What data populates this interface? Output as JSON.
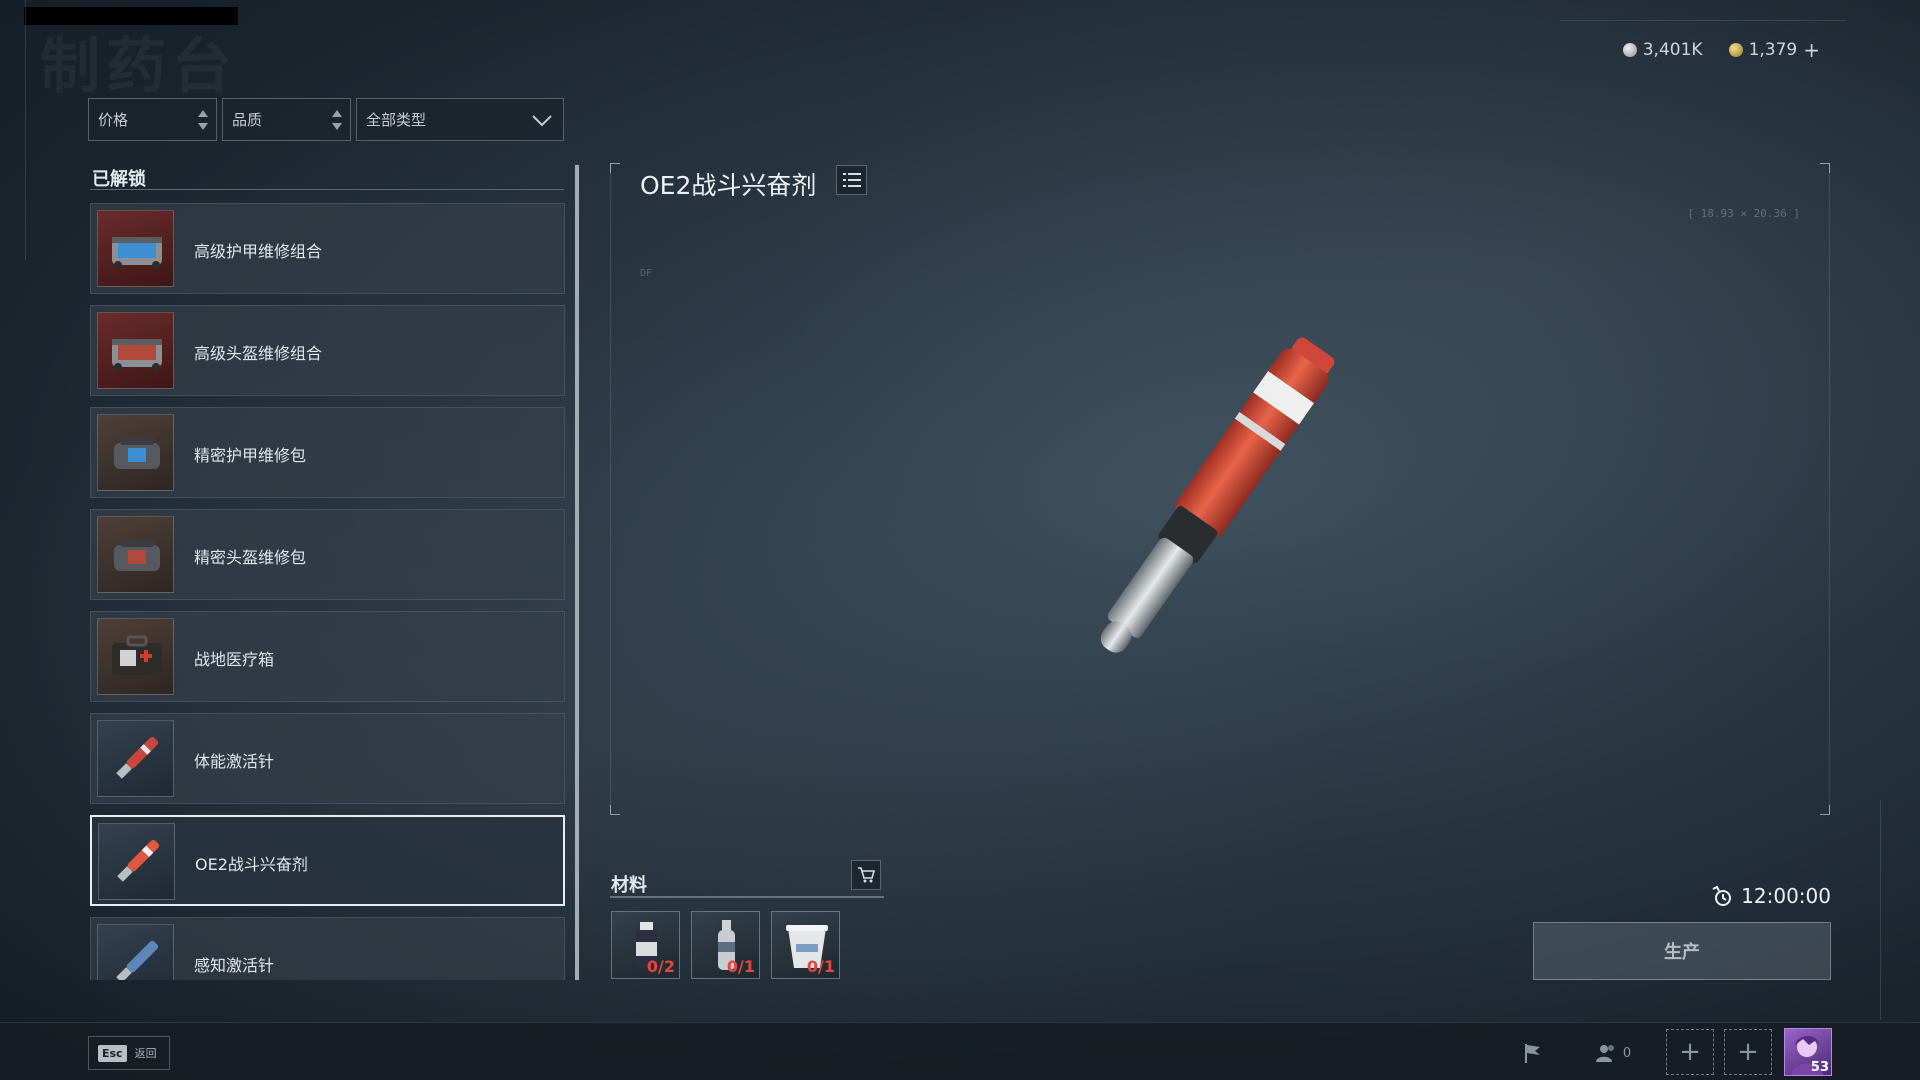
{
  "header": {
    "page_title_ghost": "制药台"
  },
  "currency": {
    "silver_value": "3,401K",
    "gold_value": "1,379",
    "gold_add_symbol": "+"
  },
  "filters": {
    "price_label": "价格",
    "quality_label": "品质",
    "type_label": "全部类型"
  },
  "recipe_list": {
    "section_title": "已解锁",
    "items": [
      {
        "label": "高级护甲维修组合"
      },
      {
        "label": "高级头盔维修组合"
      },
      {
        "label": "精密护甲维修包"
      },
      {
        "label": "精密头盔维修包"
      },
      {
        "label": "战地医疗箱"
      },
      {
        "label": "体能激活针"
      },
      {
        "label": "OE2战斗兴奋剂",
        "selected": true
      },
      {
        "label": "感知激活针"
      }
    ]
  },
  "detail": {
    "item_name": "OE2战斗兴奋剂",
    "dimension_readout": "[ 18.93 × 20.36 ]",
    "faint_code": "DF"
  },
  "materials": {
    "title": "材料",
    "slots": [
      {
        "icon": "vial-icon",
        "count": "0/2"
      },
      {
        "icon": "bottle-icon",
        "count": "0/1"
      },
      {
        "icon": "cup-icon",
        "count": "0/1"
      }
    ]
  },
  "production": {
    "time": "12:00:00",
    "produce_label": "生产"
  },
  "bottom_bar": {
    "esc_key": "Esc",
    "esc_label": "返回",
    "team_count": "0",
    "player_level": "53"
  },
  "colors": {
    "accent_red": "#e2483f",
    "selected_border": "#e9edf0"
  }
}
